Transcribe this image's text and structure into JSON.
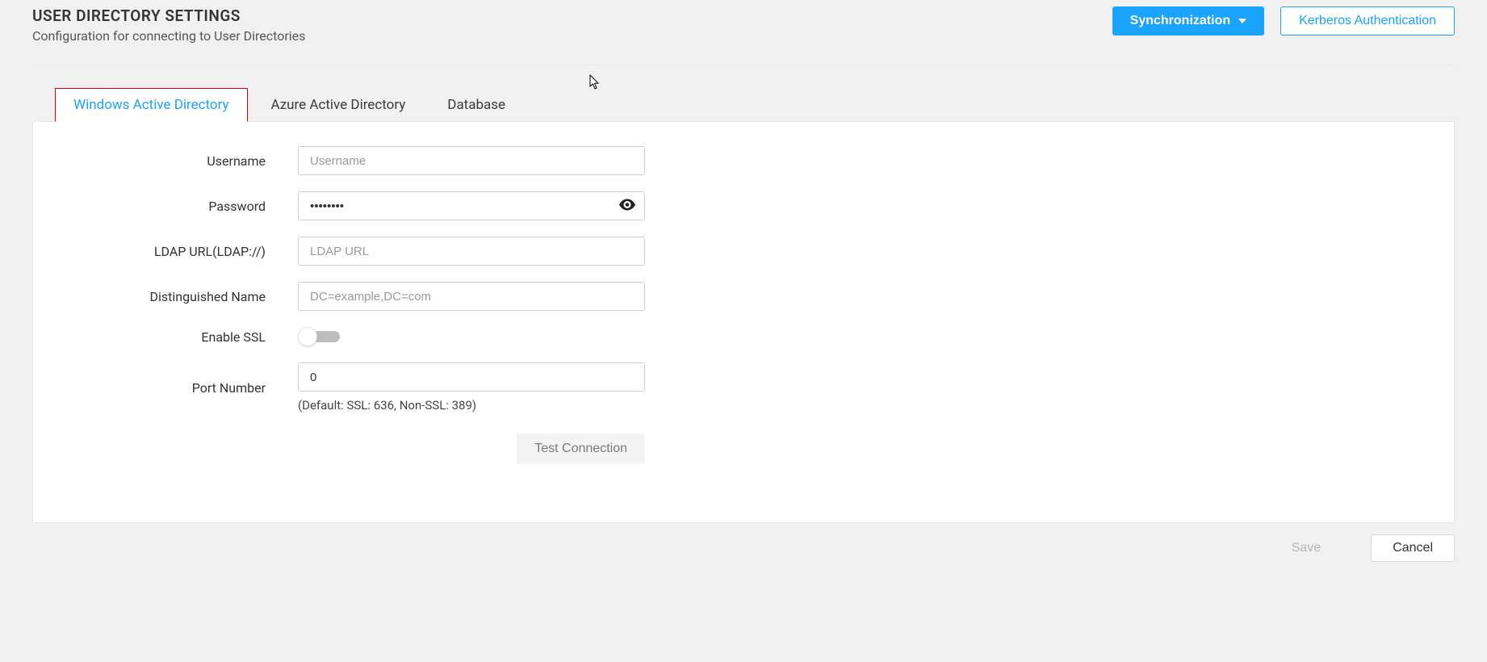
{
  "header": {
    "title": "USER DIRECTORY SETTINGS",
    "subtitle": "Configuration for connecting to User Directories",
    "sync_button": "Synchronization",
    "kerberos_button": "Kerberos Authentication"
  },
  "tabs": {
    "active": 0,
    "items": [
      "Windows Active Directory",
      "Azure Active Directory",
      "Database"
    ]
  },
  "form": {
    "username": {
      "label": "Username",
      "value": "",
      "placeholder": "Username"
    },
    "password": {
      "label": "Password",
      "value": "••••••••"
    },
    "ldap_url": {
      "label": "LDAP URL(LDAP://)",
      "value": "",
      "placeholder": "LDAP URL"
    },
    "dn": {
      "label": "Distinguished Name",
      "value": "",
      "placeholder": "DC=example,DC=com"
    },
    "enable_ssl": {
      "label": "Enable SSL",
      "value": false
    },
    "port": {
      "label": "Port Number",
      "value": "0",
      "help": "(Default: SSL: 636, Non-SSL: 389)"
    },
    "test_connection": "Test Connection"
  },
  "footer": {
    "save": "Save",
    "cancel": "Cancel"
  }
}
